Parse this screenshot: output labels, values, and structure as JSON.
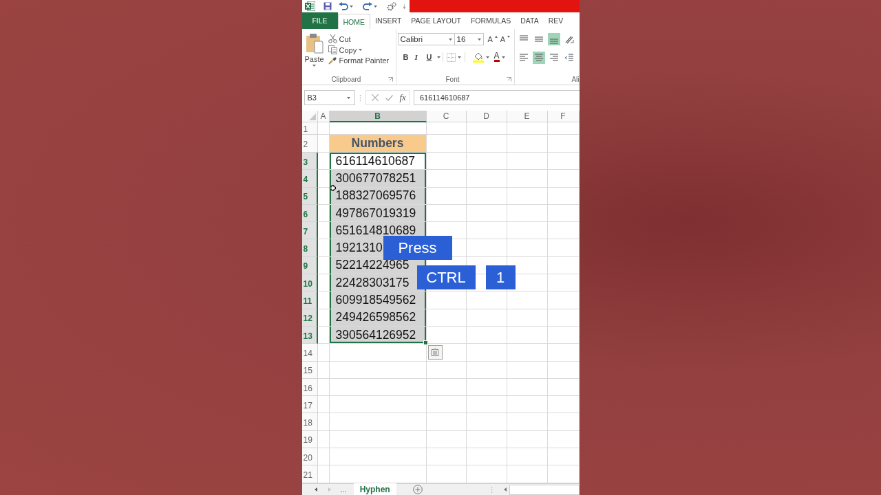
{
  "tabs": [
    {
      "label": "FILE",
      "kind": "file",
      "selected": false
    },
    {
      "label": "HOME",
      "kind": "tab",
      "selected": true
    },
    {
      "label": "INSERT",
      "kind": "tab",
      "selected": false
    },
    {
      "label": "PAGE LAYOUT",
      "kind": "tab",
      "selected": false
    },
    {
      "label": "FORMULAS",
      "kind": "tab",
      "selected": false
    },
    {
      "label": "DATA",
      "kind": "tab",
      "selected": false
    },
    {
      "label": "REV",
      "kind": "tab",
      "selected": false
    }
  ],
  "clipboard": {
    "paste": "Paste",
    "cut": "Cut",
    "copy": "Copy",
    "format_painter": "Format Painter",
    "label": "Clipboard"
  },
  "font": {
    "name": "Calibri",
    "size": "16",
    "grow": "A",
    "shrink": "A",
    "bold": "B",
    "italic": "I",
    "underline": "U",
    "font_color": "A",
    "label": "Font"
  },
  "alignment": {
    "label": "Ali",
    "buttons": [
      {
        "kind": "align-top",
        "on": false
      },
      {
        "kind": "align-middle",
        "on": false
      },
      {
        "kind": "align-bottom",
        "on": true
      },
      {
        "kind": "orientation",
        "on": false
      },
      {
        "kind": "align-left",
        "on": false
      },
      {
        "kind": "align-center",
        "on": true
      },
      {
        "kind": "align-right",
        "on": false
      },
      {
        "kind": "indent",
        "on": false
      }
    ]
  },
  "formula_bar": {
    "name_box": "B3",
    "function_label": "fx",
    "value": "616114610687"
  },
  "columns": [
    {
      "label": "A",
      "selected": false
    },
    {
      "label": "B",
      "selected": true
    },
    {
      "label": "C",
      "selected": false
    },
    {
      "label": "D",
      "selected": false
    },
    {
      "label": "E",
      "selected": false
    },
    {
      "label": "F",
      "selected": false
    }
  ],
  "rows": [
    {
      "number": "1",
      "selected": false
    },
    {
      "number": "2",
      "selected": false,
      "b": {
        "text": "Numbers",
        "kind": "header",
        "active": false
      }
    },
    {
      "number": "3",
      "selected": true,
      "b": {
        "text": "616114610687",
        "kind": "number",
        "active": true
      }
    },
    {
      "number": "4",
      "selected": true,
      "b": {
        "text": "300677078251",
        "kind": "number",
        "active": false
      }
    },
    {
      "number": "5",
      "selected": true,
      "b": {
        "text": "188327069576",
        "kind": "number",
        "active": false
      }
    },
    {
      "number": "6",
      "selected": true,
      "b": {
        "text": "497867019319",
        "kind": "number",
        "active": false
      }
    },
    {
      "number": "7",
      "selected": true,
      "b": {
        "text": "651614810689",
        "kind": "number",
        "active": false
      }
    },
    {
      "number": "8",
      "selected": true,
      "b": {
        "text": "1921310",
        "kind": "number",
        "active": false
      }
    },
    {
      "number": "9",
      "selected": true,
      "b": {
        "text": "52214224965",
        "kind": "number",
        "active": false
      }
    },
    {
      "number": "10",
      "selected": true,
      "b": {
        "text": "22428303175",
        "kind": "number",
        "active": false
      }
    },
    {
      "number": "11",
      "selected": true,
      "b": {
        "text": "609918549562",
        "kind": "number",
        "active": false
      }
    },
    {
      "number": "12",
      "selected": true,
      "b": {
        "text": "249426598562",
        "kind": "number",
        "active": false
      }
    },
    {
      "number": "13",
      "selected": true,
      "b": {
        "text": "390564126952",
        "kind": "number",
        "active": false
      }
    },
    {
      "number": "14",
      "selected": false
    },
    {
      "number": "15",
      "selected": false
    },
    {
      "number": "16",
      "selected": false
    },
    {
      "number": "17",
      "selected": false
    },
    {
      "number": "18",
      "selected": false
    },
    {
      "number": "19",
      "selected": false
    },
    {
      "number": "20",
      "selected": false
    },
    {
      "number": "21",
      "selected": false
    }
  ],
  "sheet_tabs": {
    "more": "...",
    "sheets": [
      {
        "label": "Hyphen",
        "selected": true
      }
    ]
  },
  "overlay_keys": [
    {
      "label": "Press"
    },
    {
      "label": "CTRL"
    },
    {
      "label": "1"
    }
  ]
}
